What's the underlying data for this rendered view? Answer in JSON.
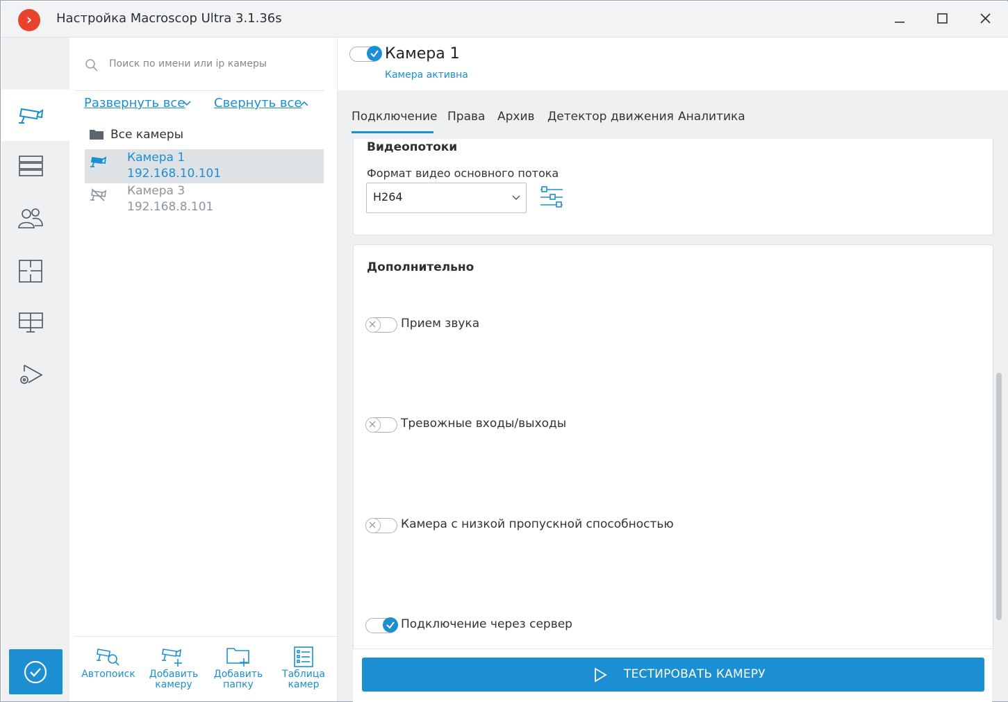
{
  "window": {
    "title": "Настройка Macroscop Ultra 3.1.36s",
    "logo_glyph": "›",
    "minimize_icon": "minimize-icon",
    "maximize_icon": "maximize-icon",
    "close_icon": "close-icon"
  },
  "rail": {
    "items": [
      {
        "name": "cameras",
        "icon": "camera-icon",
        "active": true
      },
      {
        "name": "servers",
        "icon": "server-icon",
        "active": false
      },
      {
        "name": "users",
        "icon": "users-icon",
        "active": false
      },
      {
        "name": "layouts",
        "icon": "layout-icon",
        "active": false
      },
      {
        "name": "monitors",
        "icon": "monitor-icon",
        "active": false
      },
      {
        "name": "modules",
        "icon": "play-settings-icon",
        "active": false
      }
    ],
    "apply_icon": "check-circle-icon"
  },
  "tree": {
    "search_placeholder": "Поиск по имени или ip камеры",
    "expand_all": "Развернуть все",
    "collapse_all": "Свернуть все",
    "root_folder": "Все камеры",
    "cameras": [
      {
        "name": "Камера 1",
        "ip": "192.168.10.101",
        "selected": true,
        "active": true
      },
      {
        "name": "Камера 3",
        "ip": "192.168.8.101",
        "selected": false,
        "active": false
      }
    ],
    "bottom": {
      "autosearch": "Автопоиск",
      "add_camera": "Добавить камеру",
      "add_folder": "Добавить папку",
      "camera_table": "Таблица камер"
    }
  },
  "camera": {
    "title": "Камера 1",
    "status": "Камера активна",
    "enabled": true
  },
  "tabs": [
    "Подключение",
    "Права",
    "Архив",
    "Детектор движения",
    "Аналитика"
  ],
  "active_tab": 0,
  "video_streams": {
    "title": "Видеопотоки",
    "format_label": "Формат видео основного потока",
    "format_value": "H264"
  },
  "additional": {
    "title": "Дополнительно",
    "options": [
      {
        "label": "Прием звука",
        "enabled": false
      },
      {
        "label": "Тревожные входы/выходы",
        "enabled": false
      },
      {
        "label": "Камера с низкой пропускной способностью",
        "enabled": false
      },
      {
        "label": "Подключение через сервер",
        "enabled": true
      }
    ]
  },
  "test_button": "ТЕСТИРОВАТЬ КАМЕРУ",
  "colors": {
    "accent": "#1b8fd2",
    "logo": "#e8432c"
  }
}
